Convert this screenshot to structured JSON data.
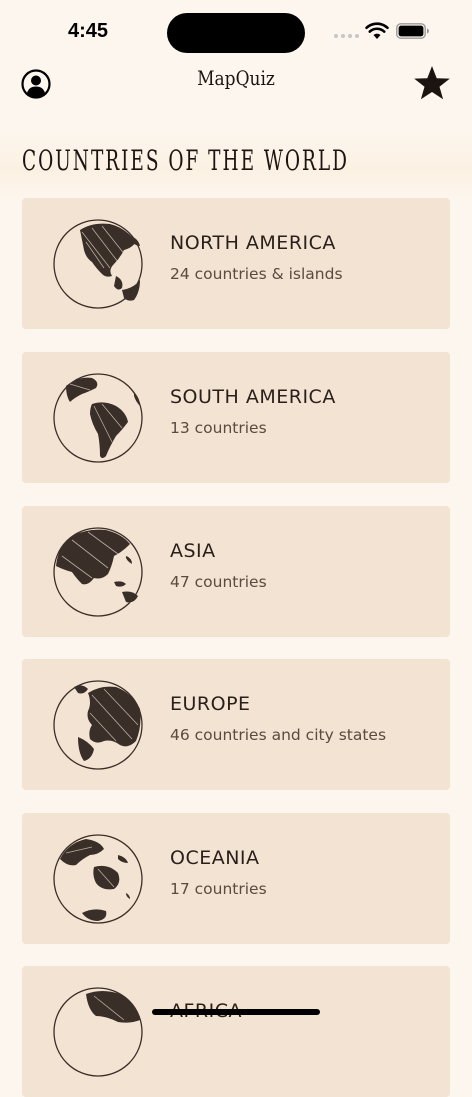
{
  "status": {
    "time": "4:45"
  },
  "nav": {
    "title": "MapQuiz",
    "profile_icon": "person-circle-icon",
    "favorites_icon": "star-icon"
  },
  "section": {
    "title": "COUNTRIES OF THE WORLD"
  },
  "regions": [
    {
      "name": "NORTH AMERICA",
      "count": "24 countries & islands",
      "icon": "globe-north-america-icon"
    },
    {
      "name": "SOUTH AMERICA",
      "count": "13 countries",
      "icon": "globe-south-america-icon"
    },
    {
      "name": "ASIA",
      "count": "47 countries",
      "icon": "globe-asia-icon"
    },
    {
      "name": "EUROPE",
      "count": "46 countries and city states",
      "icon": "globe-europe-icon"
    },
    {
      "name": "OCEANIA",
      "count": "17 countries",
      "icon": "globe-oceania-icon"
    },
    {
      "name": "AFRICA",
      "count": "",
      "icon": "globe-africa-icon"
    }
  ],
  "colors": {
    "background": "#fdf6ee",
    "card": "#f3e3d3",
    "text": "#2a1f1a"
  }
}
